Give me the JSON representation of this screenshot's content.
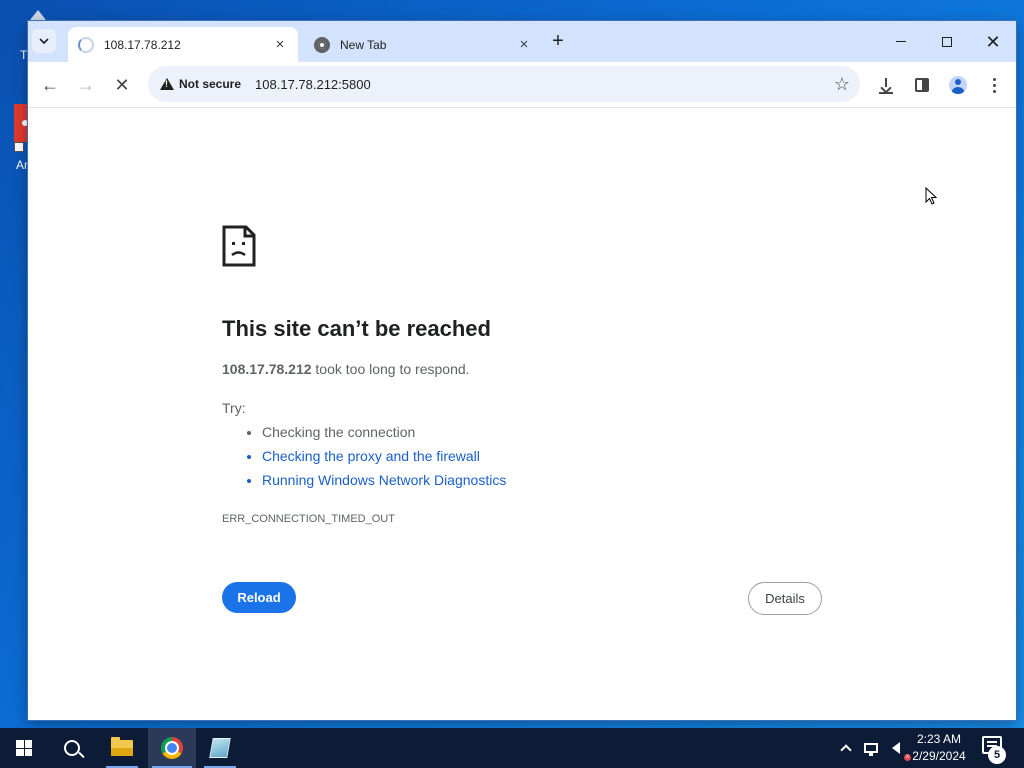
{
  "desktop": {
    "fragment_1": "Ti",
    "fragment_2": "Ar"
  },
  "browser": {
    "tabs": [
      {
        "title": "108.17.78.212",
        "state": "loading",
        "active": true
      },
      {
        "title": "New Tab",
        "state": "idle",
        "active": false
      }
    ],
    "icons": {
      "tab_search": "chevron-down-icon",
      "close_tab": "close-icon",
      "new_tab": "plus-icon",
      "minimize": "minimize-icon",
      "maximize": "maximize-icon",
      "close_window": "close-icon",
      "back": "arrow-left-icon",
      "forward": "arrow-right-icon",
      "stop": "close-icon",
      "security": "warning-icon",
      "bookmark": "star-icon",
      "download": "download-icon",
      "side_panel": "side-panel-icon",
      "profile": "profile-icon",
      "menu": "more-vert-icon"
    },
    "tab_close_glyph": "×",
    "new_tab_glyph": "+",
    "close_glyph": "✕",
    "back_glyph": "←",
    "forward_glyph": "→",
    "stop_glyph": "✕",
    "star_glyph": "☆",
    "security_chip": "Not secure",
    "url": "108.17.78.212:5800"
  },
  "error_page": {
    "headline": "This site can’t be reached",
    "host": "108.17.78.212",
    "message_suffix": " took too long to respond.",
    "try_label": "Try:",
    "suggestions": [
      {
        "text": "Checking the connection",
        "link": false
      },
      {
        "text": "Checking the proxy and the firewall",
        "link": true
      },
      {
        "text": "Running Windows Network Diagnostics",
        "link": true
      }
    ],
    "error_code": "ERR_CONNECTION_TIMED_OUT",
    "reload_label": "Reload",
    "details_label": "Details"
  },
  "taskbar": {
    "apps": [
      {
        "name": "Start",
        "icon": "windows-icon"
      },
      {
        "name": "Search",
        "icon": "search-icon"
      },
      {
        "name": "File Explorer",
        "icon": "folder-icon"
      },
      {
        "name": "Google Chrome",
        "icon": "chrome-icon"
      },
      {
        "name": "Notepad",
        "icon": "notepad-icon"
      }
    ],
    "time": "2:23 AM",
    "date": "2/29/2024",
    "notification_count": "5"
  },
  "colors": {
    "tabstrip": "#d3e3fd",
    "omnibox": "#edf2fa",
    "link": "#1a5fc8",
    "reload_button": "#1a73e8",
    "taskbar": "#0c1b36"
  }
}
